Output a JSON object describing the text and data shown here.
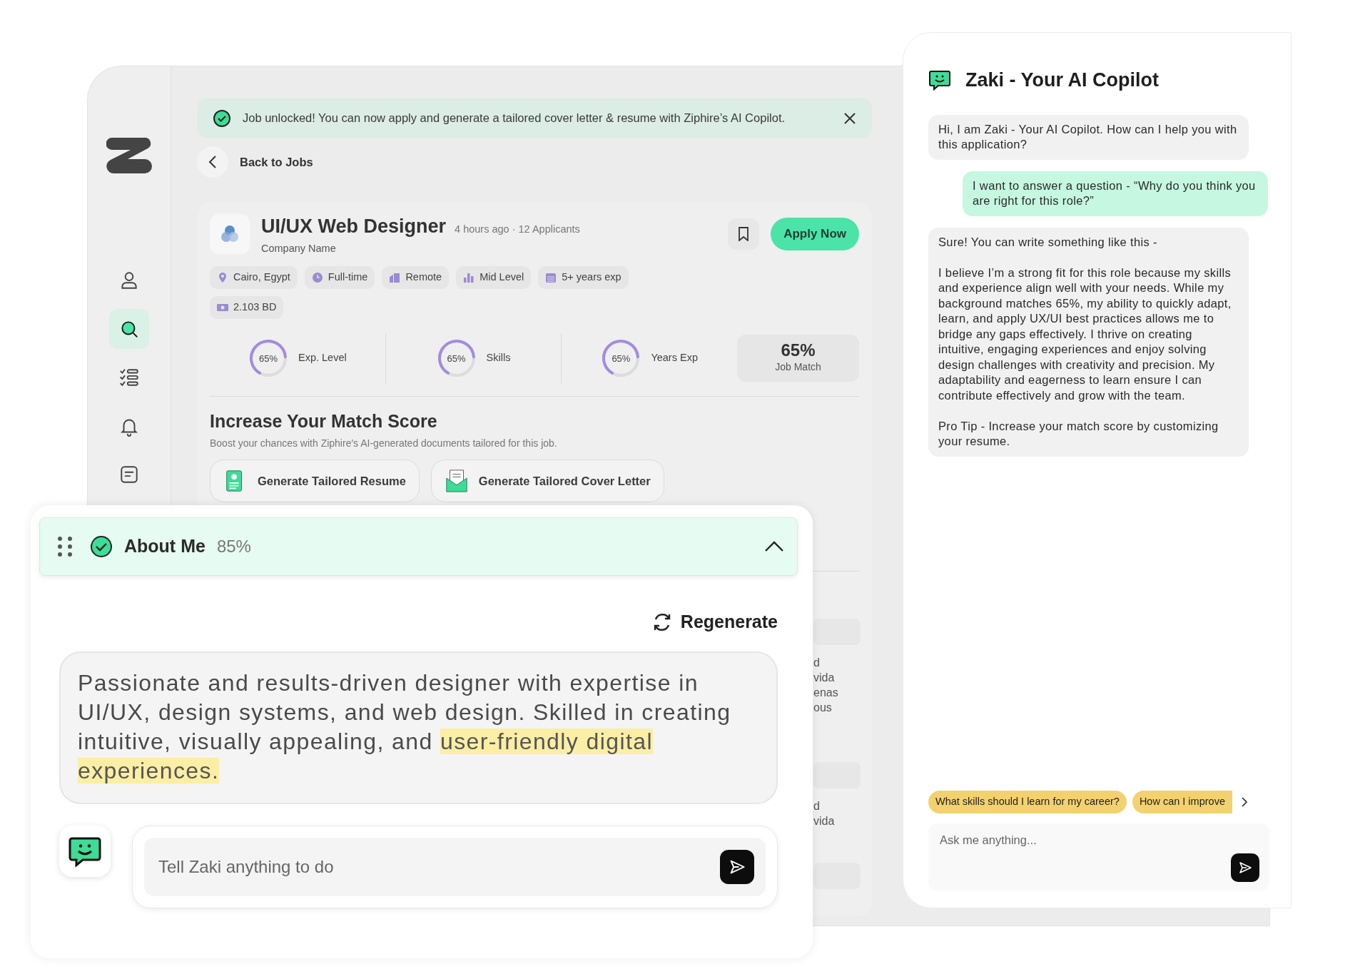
{
  "sidebar": {
    "items": [
      {
        "kind": "profile",
        "selected": false
      },
      {
        "kind": "search",
        "selected": true
      },
      {
        "kind": "checklist",
        "selected": false
      },
      {
        "kind": "bell",
        "selected": false
      },
      {
        "kind": "document",
        "selected": false
      }
    ]
  },
  "banner": {
    "message": "Job unlocked! You can now apply and generate a tailored cover letter & resume with Ziphire’s AI Copilot."
  },
  "back_link": "Back to Jobs",
  "job": {
    "title": "UI/UX Web Designer",
    "meta": "4 hours ago · 12 Applicants",
    "company": "Company Name",
    "apply": "Apply Now",
    "tags": [
      {
        "kind": "location",
        "label": "Cairo, Egypt"
      },
      {
        "kind": "time",
        "label": "Full-time"
      },
      {
        "kind": "building",
        "label": "Remote"
      },
      {
        "kind": "level",
        "label": "Mid Level"
      },
      {
        "kind": "calendar",
        "label": "5+ years exp"
      },
      {
        "kind": "money",
        "label": "2.103 BD"
      }
    ],
    "stats": [
      {
        "reading": "65%",
        "label": "Exp. Level",
        "level": 0.65
      },
      {
        "reading": "65%",
        "label": "Skills",
        "level": 0.65
      },
      {
        "reading": "65%",
        "label": "Years Exp",
        "level": 0.65
      }
    ],
    "match": {
      "value": "65%",
      "label": "Job Match"
    }
  },
  "match_score": {
    "title": "Increase Your Match Score",
    "subtitle": "Boost your chances with Ziphire's AI-generated documents tailored for this job.",
    "actions": [
      {
        "kind": "resume",
        "label": "Generate Tailored Resume"
      },
      {
        "kind": "letter",
        "label": "Generate Tailored Cover Letter"
      }
    ]
  },
  "hidden_fragments": [
    {
      "lines": [
        "d",
        "vida",
        "enas",
        "ous"
      ]
    },
    {
      "lines": [
        "d",
        "vida"
      ]
    }
  ],
  "copilot": {
    "title": "Zaki - Your AI Copilot",
    "messages": [
      {
        "kind": "bot",
        "paragraphs": [
          "Hi, I am Zaki - Your AI Copilot. How can I help you with this application?"
        ]
      },
      {
        "kind": "user",
        "paragraphs": [
          "I want to answer a question - “Why do you think you are right for this role?”"
        ]
      },
      {
        "kind": "bot",
        "paragraphs": [
          "Sure! You can write something like this -",
          "I believe I’m a strong fit for this role because my skills and experience align well with your needs. While my background matches 65%, my ability to quickly adapt, learn, and apply UX/UI best practices allows me to bridge any gaps effectively. I thrive on creating intuitive, engaging experiences and enjoy solving design challenges with creativity and precision. My adaptability and eagerness to learn ensure I can contribute effectively and grow with the team.",
          "Pro Tip - Increase your match score by customizing your resume."
        ]
      }
    ],
    "suggestions": [
      "What skills should I learn for my career?",
      "How can I improve"
    ],
    "input": {
      "placeholder": "Ask me anything..."
    }
  },
  "about_me": {
    "title": "About Me",
    "percent": "85%",
    "checked": true,
    "expanded": true,
    "regenerate": "Regenerate",
    "text": "Passionate and results-driven designer with expertise in UI/UX, design systems, and web design. Skilled in creating intuitive, visually appealing, and ",
    "highlight": "user-friendly digital experiences.",
    "input": {
      "placeholder": "Tell Zaki anything to do"
    }
  }
}
